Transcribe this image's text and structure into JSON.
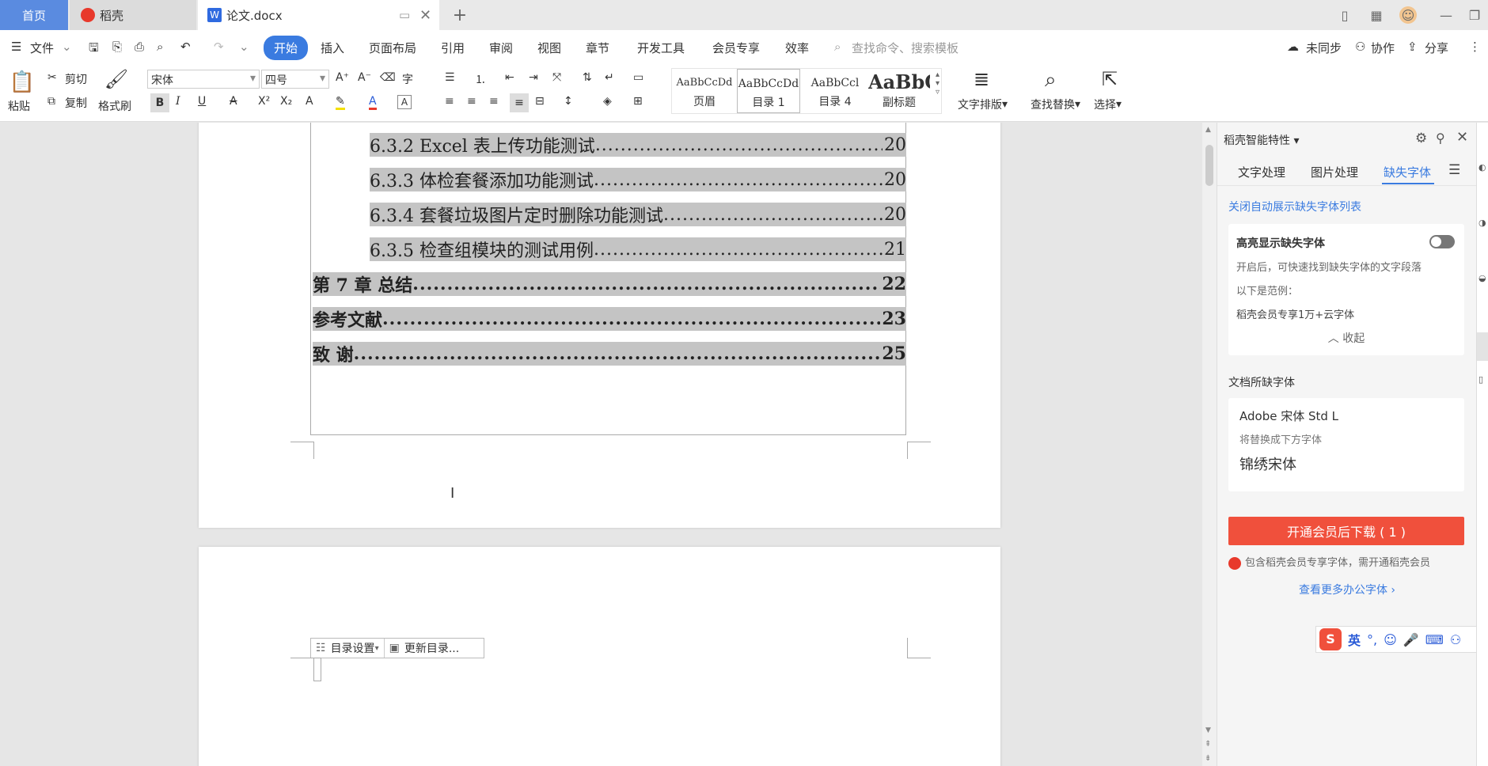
{
  "tabs": {
    "home": "首页",
    "daoke": "稻壳",
    "doc": "论文.docx"
  },
  "menu": {
    "file": "文件",
    "start": "开始",
    "insert": "插入",
    "layout": "页面布局",
    "reference": "引用",
    "review": "审阅",
    "view": "视图",
    "chapter": "章节",
    "devtools": "开发工具",
    "member": "会员专享",
    "efficiency": "效率",
    "search_placeholder": "查找命令、搜索模板",
    "unsync": "未同步",
    "collab": "协作",
    "share": "分享"
  },
  "ribbon": {
    "paste": "粘贴",
    "cut": "剪切",
    "copy": "复制",
    "format_painter": "格式刷",
    "font": "宋体",
    "size": "四号",
    "styles": [
      {
        "preview": "AaBbCcDd",
        "name": "页眉"
      },
      {
        "preview": "AaBbCcDd",
        "name": "目录 1"
      },
      {
        "preview": "AaBbCcl",
        "name": "目录 4"
      },
      {
        "preview": "AaBbC",
        "name": "副标题"
      }
    ],
    "text_layout": "文字排版",
    "find_replace": "查找替换",
    "select": "选择"
  },
  "toc": [
    {
      "title": "6.3.2  Excel 表上传功能测试",
      "page": "20",
      "level": 2
    },
    {
      "title": "6.3.3  体检套餐添加功能测试",
      "page": "20",
      "level": 2
    },
    {
      "title": "6.3.4  套餐垃圾图片定时删除功能测试",
      "page": "20",
      "level": 2
    },
    {
      "title": "6.3.5  检查组模块的测试用例",
      "page": "21",
      "level": 2
    },
    {
      "title": "第 7 章  总结",
      "page": "22",
      "level": 1
    },
    {
      "title": "参考文献",
      "page": "23",
      "level": 1
    },
    {
      "title": "致    谢",
      "page": "25",
      "level": 1
    }
  ],
  "toc_tools": {
    "settings": "目录设置",
    "update": "更新目录..."
  },
  "panel": {
    "title": "稻壳智能特性",
    "tabs": [
      "文字处理",
      "图片处理",
      "缺失字体"
    ],
    "close_auto": "关闭自动展示缺失字体列表",
    "highlight_title": "高亮显示缺失字体",
    "highlight_desc": "开启后，可快速找到缺失字体的文字段落",
    "example_label": "以下是范例：",
    "example_text": "稻壳会员专享1万+云字体",
    "collapse": "收起",
    "missing_title": "文档所缺字体",
    "missing_font": "Adobe 宋体 Std L",
    "replace_hint": "将替换成下方字体",
    "replace_font": "锦绣宋体",
    "download_btn": "开通会员后下载 ( 1 )",
    "notice": "包含稻壳会员专享字体，需开通稻壳会员",
    "more_fonts": "查看更多办公字体"
  },
  "ime": {
    "lang": "英"
  },
  "colors": {
    "accent": "#3a7be0",
    "red": "#f0503c",
    "toc_bg": "#c4c4c4"
  }
}
